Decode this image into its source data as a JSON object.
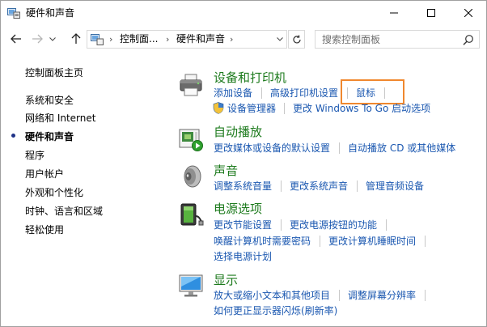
{
  "window": {
    "title": "硬件和声音"
  },
  "addressbar": {
    "crumbs": [
      "控制面...",
      "硬件和声音"
    ],
    "search_placeholder": "搜索控制面板"
  },
  "leftnav": {
    "items": [
      {
        "label": "控制面板主页",
        "active": false
      },
      {
        "label": "系统和安全",
        "active": false
      },
      {
        "label": "网络和 Internet",
        "active": false
      },
      {
        "label": "硬件和声音",
        "active": true
      },
      {
        "label": "程序",
        "active": false
      },
      {
        "label": "用户帐户",
        "active": false
      },
      {
        "label": "外观和个性化",
        "active": false
      },
      {
        "label": "时钟、语言和区域",
        "active": false
      },
      {
        "label": "轻松使用",
        "active": false
      }
    ]
  },
  "categories": {
    "devices": {
      "title": "设备和打印机",
      "links": [
        "添加设备",
        "高级打印机设置",
        "鼠标",
        "设备管理器",
        "更改 Windows To Go 启动选项"
      ]
    },
    "autoplay": {
      "title": "自动播放",
      "links": [
        "更改媒体或设备的默认设置",
        "自动播放 CD 或其他媒体"
      ]
    },
    "sound": {
      "title": "声音",
      "links": [
        "调整系统音量",
        "更改系统声音",
        "管理音频设备"
      ]
    },
    "power": {
      "title": "电源选项",
      "links": [
        "更改节能设置",
        "更改电源按钮的功能",
        "唤醒计算机时需要密码",
        "更改计算机睡眠时间",
        "选择电源计划"
      ]
    },
    "display": {
      "title": "显示",
      "links": [
        "放大或缩小文本和其他项目",
        "调整屏幕分辨率",
        "如何更正显示器闪烁(刷新率)"
      ]
    }
  },
  "colors": {
    "link": "#1a57b0",
    "category_title": "#1e7b1e",
    "highlight": "#f0882e"
  }
}
